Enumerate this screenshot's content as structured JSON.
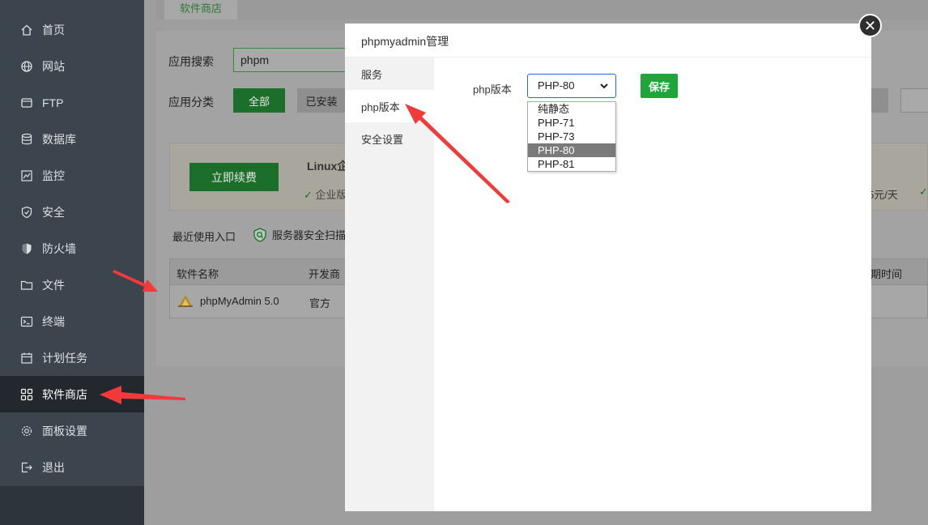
{
  "sidebar": {
    "items": [
      {
        "label": "首页",
        "icon": "home-icon"
      },
      {
        "label": "网站",
        "icon": "globe-icon"
      },
      {
        "label": "FTP",
        "icon": "ftp-icon"
      },
      {
        "label": "数据库",
        "icon": "database-icon"
      },
      {
        "label": "监控",
        "icon": "monitor-icon"
      },
      {
        "label": "安全",
        "icon": "shield-icon"
      },
      {
        "label": "防火墙",
        "icon": "firewall-icon"
      },
      {
        "label": "文件",
        "icon": "folder-icon"
      },
      {
        "label": "终端",
        "icon": "terminal-icon"
      },
      {
        "label": "计划任务",
        "icon": "calendar-icon"
      },
      {
        "label": "软件商店",
        "icon": "grid-icon"
      },
      {
        "label": "面板设置",
        "icon": "gear-icon"
      },
      {
        "label": "退出",
        "icon": "logout-icon"
      }
    ],
    "active_index": 10
  },
  "page": {
    "tab": "软件商店",
    "search_label": "应用搜索",
    "search_value": "phpm",
    "category_label": "应用分类",
    "cat_all": "全部",
    "cat_installed": "已安装",
    "renew_button": "立即续费",
    "banner_title": "Linux企",
    "banner_feature": "企业版",
    "banner_price": "5元/天",
    "recent_label": "最近使用入口",
    "scan_label": "服务器安全扫描",
    "table": {
      "col_name": "软件名称",
      "col_dev": "开发商",
      "col_expire": "期时间",
      "row_name": "phpMyAdmin 5.0",
      "row_dev": "官方"
    }
  },
  "modal": {
    "title": "phpmyadmin管理",
    "tabs": [
      "服务",
      "php版本",
      "安全设置"
    ],
    "active_tab": 1,
    "field_label": "php版本",
    "selected_value": "PHP-80",
    "options": [
      "纯静态",
      "PHP-71",
      "PHP-73",
      "PHP-80",
      "PHP-81"
    ],
    "highlighted_option": 3,
    "save_label": "保存",
    "close_symbol": "✕"
  }
}
